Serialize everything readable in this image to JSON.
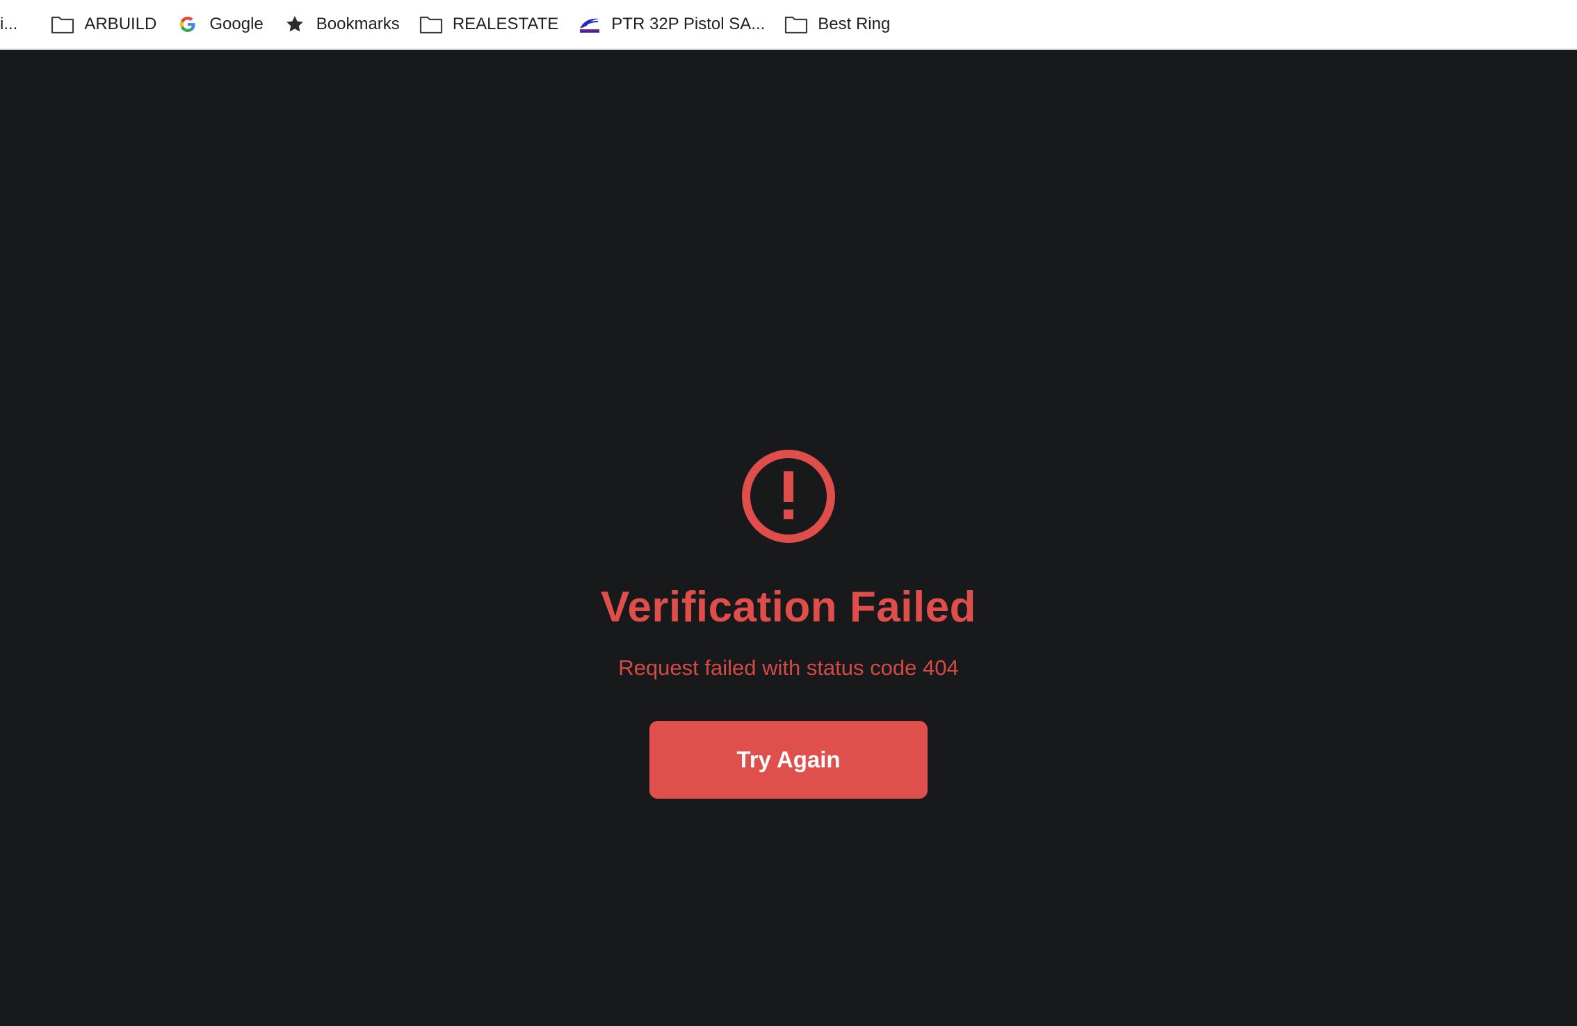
{
  "bookmarks_bar": {
    "truncated_item": "i...",
    "items": [
      {
        "label": "ARBUILD",
        "icon": "folder-icon"
      },
      {
        "label": "Google",
        "icon": "google-icon"
      },
      {
        "label": "Bookmarks",
        "icon": "star-icon"
      },
      {
        "label": "REALESTATE",
        "icon": "folder-icon"
      },
      {
        "label": "PTR 32P Pistol SA...",
        "icon": "site-favicon-icon"
      },
      {
        "label": "Best Ring",
        "icon": "folder-icon"
      }
    ]
  },
  "error": {
    "icon": "alert-circle-icon",
    "title": "Verification Failed",
    "message": "Request failed with status code 404",
    "button_label": "Try Again"
  },
  "colors": {
    "background": "#18191b",
    "accent_red": "#df504c",
    "bookmarks_bar_bg": "#ffffff"
  }
}
